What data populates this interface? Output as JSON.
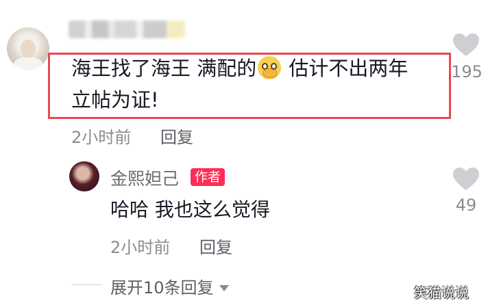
{
  "comment": {
    "line1_a": "海王找了海王 满配的",
    "emoji": "pleading-face-emoji",
    "line1_b": " 估计不出两年",
    "line2": "立帖为证!",
    "time": "2小时前",
    "reply_label": "回复",
    "likes": "195"
  },
  "reply": {
    "author": "金熙妲己",
    "badge": "作者",
    "text": "哈哈 我也这么觉得",
    "time": "2小时前",
    "reply_label": "回复",
    "likes": "49"
  },
  "expand": {
    "label": "展开10条回复"
  },
  "watermark": "笑猫说说",
  "colors": {
    "highlight": "#e8474d",
    "badge": "#fe2c55",
    "heart": "#cfcfd3"
  }
}
